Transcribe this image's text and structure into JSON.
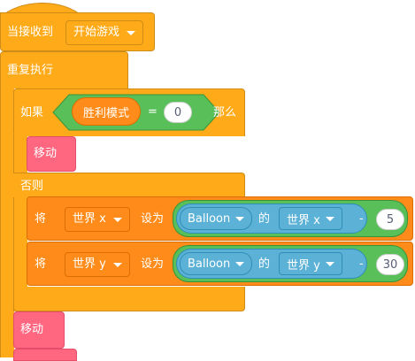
{
  "hat": {
    "label": "当接收到",
    "message": "开始游戏"
  },
  "forever": {
    "label": "重复执行"
  },
  "if_else": {
    "if_label": "如果",
    "then_label": "那么",
    "else_label": "否则",
    "condition": {
      "variable": "胜利模式",
      "operator": "=",
      "value": "0"
    },
    "then_blocks": [
      {
        "label": "移动"
      }
    ],
    "else_blocks": [
      {
        "set_label": "将",
        "variable": "世界 x",
        "to_label": "设为",
        "sprite": "Balloon",
        "of_label": "的",
        "property": "世界 x",
        "operator": "-",
        "amount": "5"
      },
      {
        "set_label": "将",
        "variable": "世界 y",
        "to_label": "设为",
        "sprite": "Balloon",
        "of_label": "的",
        "property": "世界 y",
        "operator": "-",
        "amount": "30"
      }
    ]
  },
  "after_blocks": [
    {
      "label": "移动"
    }
  ],
  "colors": {
    "events": "#ffab19",
    "control": "#ffab19",
    "variables": "#ff8c1a",
    "custom": "#ff6680",
    "operators": "#59c059",
    "sensing": "#5cb1d6"
  }
}
